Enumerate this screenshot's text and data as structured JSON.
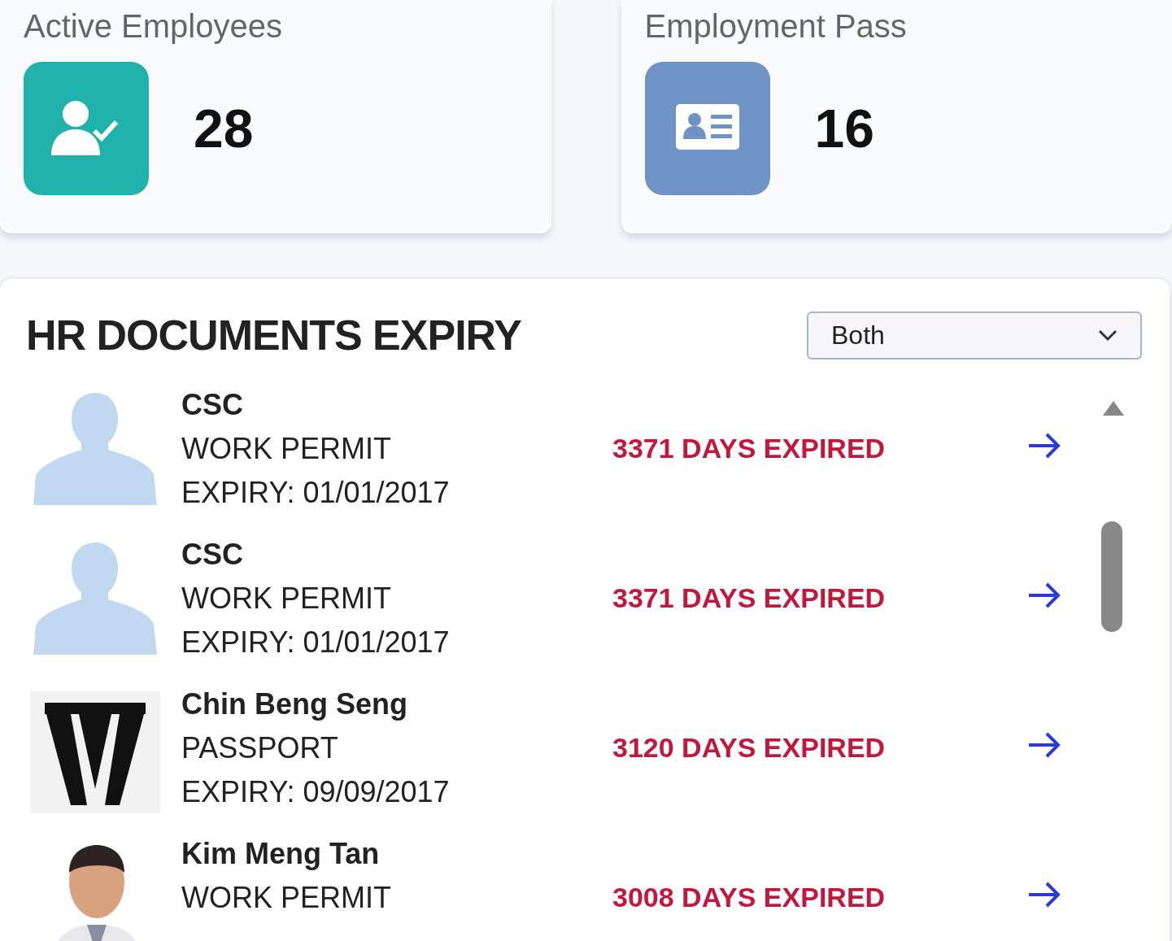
{
  "stat_cards": [
    {
      "title": "Active Employees",
      "value": "28",
      "color": "#20b2aa"
    },
    {
      "title": "Employment Pass",
      "value": "16",
      "color": "#6f93c6"
    }
  ],
  "expiry_panel": {
    "title": "HR DOCUMENTS EXPIRY",
    "filter": {
      "value": "Both"
    },
    "rows": [
      {
        "kind": "silhouette",
        "name": "CSC",
        "document": "WORK PERMIT",
        "expiry": "EXPIRY: 01/01/2017",
        "status": "3371 DAYS EXPIRED"
      },
      {
        "kind": "silhouette",
        "name": "CSC",
        "document": "WORK PERMIT",
        "expiry": "EXPIRY: 01/01/2017",
        "status": "3371 DAYS EXPIRED"
      },
      {
        "kind": "picture",
        "name": "Chin Beng Seng",
        "document": "PASSPORT",
        "expiry": "EXPIRY: 09/09/2017",
        "status": "3120 DAYS EXPIRED"
      },
      {
        "kind": "picture",
        "name": "Kim Meng Tan",
        "document": "WORK PERMIT",
        "status": "3008 DAYS EXPIRED"
      }
    ]
  }
}
